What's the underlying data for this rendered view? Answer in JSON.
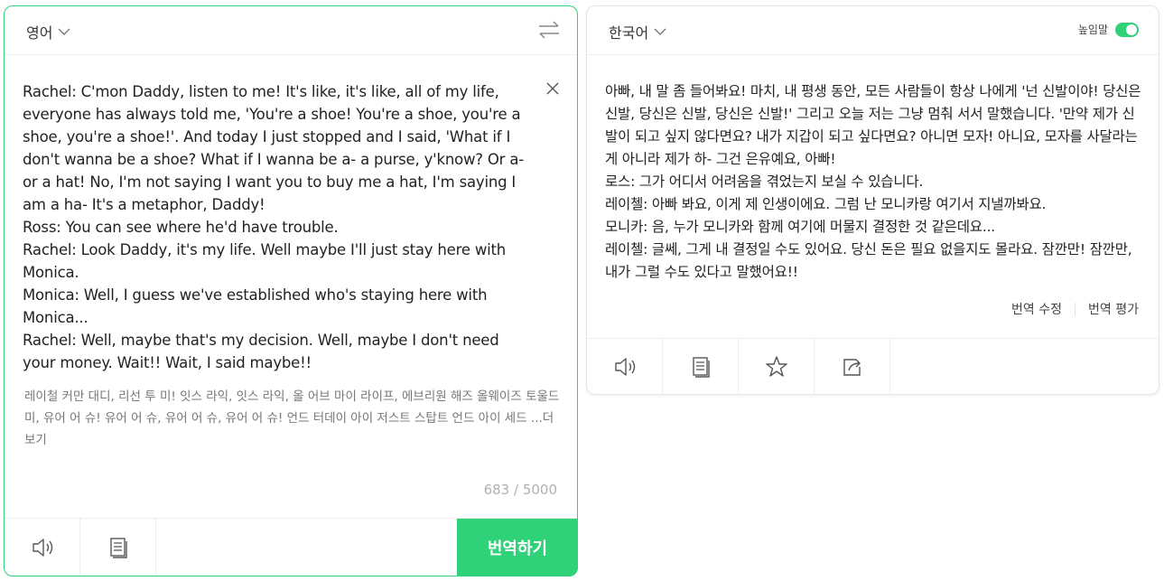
{
  "source": {
    "language": "영어",
    "text": "Rachel: C'mon Daddy, listen to me! It's like, it's like, all of my life, everyone has always told me, 'You're a shoe! You're a shoe, you're a shoe, you're a shoe!'. And today I just stopped and I said, 'What if I don't wanna be a shoe? What if I wanna be a- a purse, y'know? Or a- or a hat! No, I'm not saying I want you to buy me a hat, I'm saying I am a ha- It's a metaphor, Daddy!\nRoss: You can see where he'd have trouble.\nRachel: Look Daddy, it's my life. Well maybe I'll just stay here with Monica.\nMonica: Well, I guess we've established who's staying here with Monica...\nRachel: Well, maybe that's my decision. Well, maybe I don't need your money. Wait!! Wait, I said maybe!!",
    "pronunciation": "레이철 커만 대디, 리선 투 미! 잇스 라익, 잇스 라익, 올 어브 마이 라이프, 에브리원 해즈 올웨이즈 토울드 미, 유어 어 슈! 유어 어 슈, 유어 어 슈, 유어 어 슈! 언드 터데이 아이 저스트 스탑트 언드 아이 세드 ",
    "more_label": "...더보기",
    "char_count": "683 / 5000",
    "translate_button": "번역하기"
  },
  "target": {
    "language": "한국어",
    "honorific_label": "높임말",
    "honorific_on": true,
    "text": "아빠, 내 말 좀 들어봐요! 마치, 내 평생 동안, 모든 사람들이 항상 나에게 '넌 신발이야! 당신은 신발, 당신은 신발, 당신은 신발!' 그리고 오늘 저는 그냥 멈춰 서서 말했습니다. '만약 제가 신발이 되고 싶지 않다면요? 내가 지갑이 되고 싶다면요? 아니면 모자! 아니요, 모자를 사달라는 게 아니라 제가 하- 그건 은유예요, 아빠!\n로스: 그가 어디서 어려움을 겪었는지 보실 수 있습니다.\n레이첼: 아빠 봐요, 이게 제 인생이에요. 그럼 난 모니카랑 여기서 지낼까봐요.\n모니카: 음, 누가 모니카와 함께 여기에 머물지 결정한 것 같은데요...\n레이첼: 글쎄, 그게 내 결정일 수도 있어요. 당신 돈은 필요 없을지도 몰라요. 잠깐만! 잠깐만, 내가 그럴 수도 있다고 말했어요!!",
    "edit_label": "번역 수정",
    "rate_label": "번역 평가"
  },
  "icons": {
    "swap": "swap-icon",
    "clear": "close-icon",
    "speaker": "speaker-icon",
    "copy": "copy-icon",
    "star": "star-icon",
    "share": "share-icon"
  },
  "colors": {
    "accent": "#2fd279",
    "muted": "#777777"
  }
}
